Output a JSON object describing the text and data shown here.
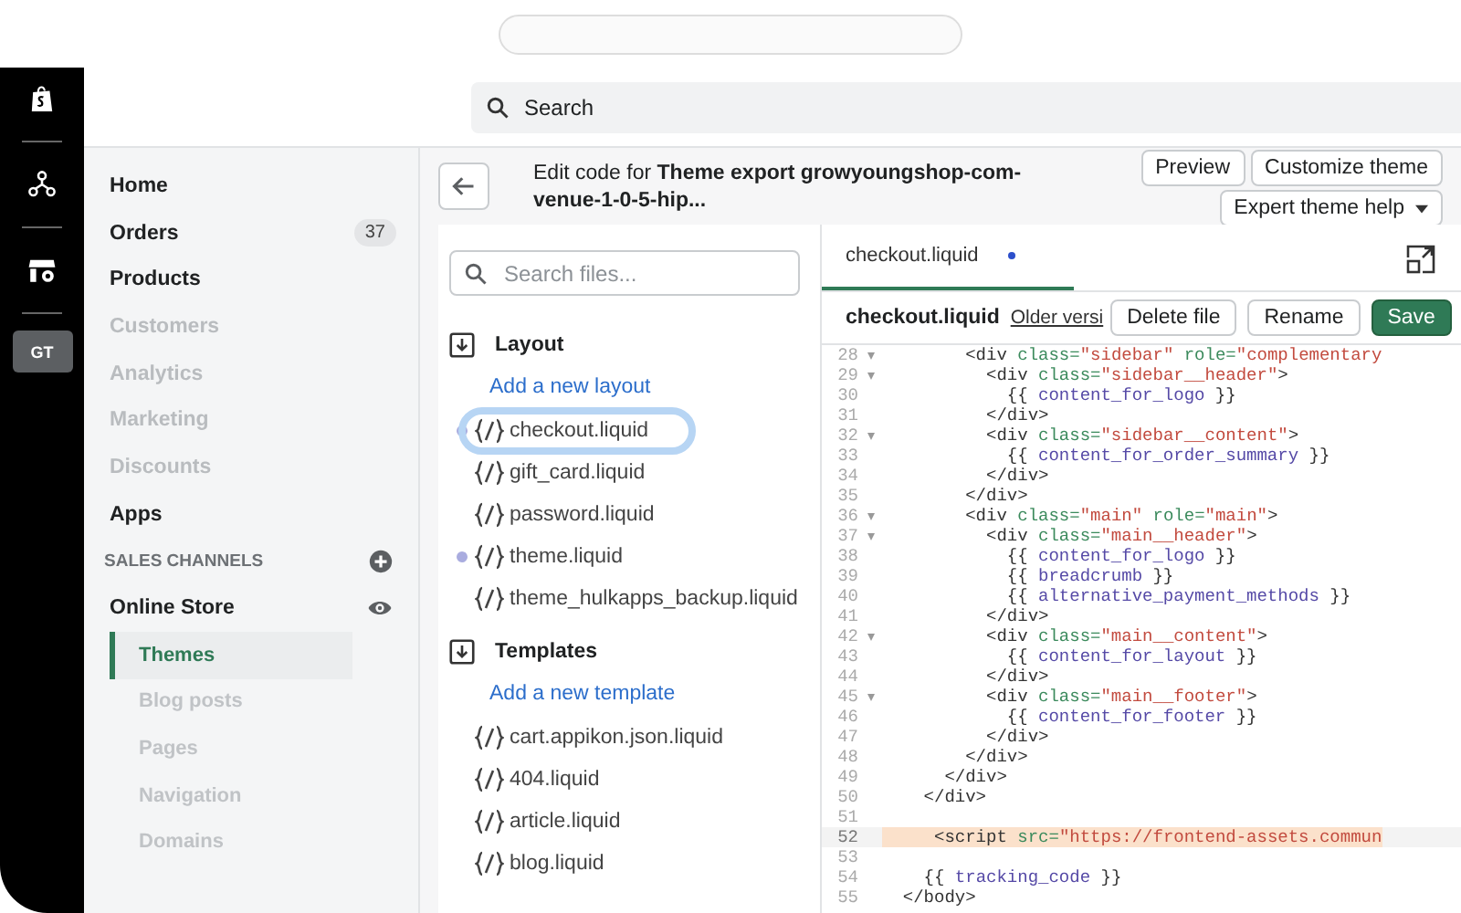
{
  "rail": {
    "avatar": "GT"
  },
  "top_search": {
    "placeholder": "Search"
  },
  "nav": {
    "items": [
      {
        "label": "Home",
        "disabled": false
      },
      {
        "label": "Orders",
        "disabled": false,
        "badge": "37"
      },
      {
        "label": "Products",
        "disabled": false
      },
      {
        "label": "Customers",
        "disabled": true
      },
      {
        "label": "Analytics",
        "disabled": true
      },
      {
        "label": "Marketing",
        "disabled": true
      },
      {
        "label": "Discounts",
        "disabled": true
      },
      {
        "label": "Apps",
        "disabled": false
      }
    ],
    "section_title": "SALES CHANNELS",
    "channel": "Online Store",
    "sub_items": [
      {
        "label": "Themes",
        "selected": true,
        "disabled": false
      },
      {
        "label": "Blog posts",
        "selected": false,
        "disabled": true
      },
      {
        "label": "Pages",
        "selected": false,
        "disabled": true
      },
      {
        "label": "Navigation",
        "selected": false,
        "disabled": true
      },
      {
        "label": "Domains",
        "selected": false,
        "disabled": true
      }
    ]
  },
  "page_header": {
    "title": "Edit code for **Theme export growyoungshop-com-venue-1-0-5-hip...**",
    "buttons": [
      "Preview",
      "Customize theme"
    ],
    "help_button": "Expert theme help"
  },
  "file_search": {
    "placeholder": "Search files..."
  },
  "sections": [
    {
      "title": "Layout",
      "add_link": "Add a new layout",
      "files": [
        {
          "name": "checkout.liquid",
          "modified": true,
          "selected": true
        },
        {
          "name": "gift_card.liquid",
          "modified": false,
          "selected": false
        },
        {
          "name": "password.liquid",
          "modified": false,
          "selected": false
        },
        {
          "name": "theme.liquid",
          "modified": true,
          "selected": false
        },
        {
          "name": "theme_hulkapps_backup.liquid",
          "modified": false,
          "selected": false
        }
      ]
    },
    {
      "title": "Templates",
      "add_link": "Add a new template",
      "files": [
        {
          "name": "cart.appikon.json.liquid",
          "modified": false,
          "selected": false
        },
        {
          "name": "404.liquid",
          "modified": false,
          "selected": false
        },
        {
          "name": "article.liquid",
          "modified": false,
          "selected": false
        },
        {
          "name": "blog.liquid",
          "modified": false,
          "selected": false
        }
      ]
    }
  ],
  "editor": {
    "tabs": [
      {
        "label": "checkout.liquid",
        "unsaved": true,
        "selected": true
      }
    ],
    "file_name": "checkout.liquid",
    "older_link": "Older versi",
    "buttons": [
      {
        "label": "Delete file",
        "kind": "secondary"
      },
      {
        "label": "Rename",
        "kind": "secondary"
      },
      {
        "label": "Save",
        "kind": "primary"
      }
    ],
    "lines": [
      {
        "n": "28",
        "fold": true,
        "active": false,
        "tokens": [
          {
            "kind": "text",
            "t": "        <div "
          },
          {
            "kind": "attr",
            "t": "class="
          },
          {
            "kind": "str",
            "t": "\"sidebar\" "
          },
          {
            "kind": "attr",
            "t": "role="
          },
          {
            "kind": "str",
            "t": "\"complementary"
          }
        ]
      },
      {
        "n": "29",
        "fold": true,
        "active": false,
        "tokens": [
          {
            "kind": "text",
            "t": "          <div "
          },
          {
            "kind": "attr",
            "t": "class="
          },
          {
            "kind": "str",
            "t": "\"sidebar__header\""
          },
          {
            "kind": "text",
            "t": ">"
          }
        ]
      },
      {
        "n": "30",
        "fold": false,
        "active": false,
        "tokens": [
          {
            "kind": "text",
            "t": "            {{ "
          },
          {
            "kind": "var",
            "t": "content_for_logo"
          },
          {
            "kind": "text",
            "t": " }}"
          }
        ]
      },
      {
        "n": "31",
        "fold": false,
        "active": false,
        "tokens": [
          {
            "kind": "text",
            "t": "          </div>"
          }
        ]
      },
      {
        "n": "32",
        "fold": true,
        "active": false,
        "tokens": [
          {
            "kind": "text",
            "t": "          <div "
          },
          {
            "kind": "attr",
            "t": "class="
          },
          {
            "kind": "str",
            "t": "\"sidebar__content\""
          },
          {
            "kind": "text",
            "t": ">"
          }
        ]
      },
      {
        "n": "33",
        "fold": false,
        "active": false,
        "tokens": [
          {
            "kind": "text",
            "t": "            {{ "
          },
          {
            "kind": "var",
            "t": "content_for_order_summary"
          },
          {
            "kind": "text",
            "t": " }}"
          }
        ]
      },
      {
        "n": "34",
        "fold": false,
        "active": false,
        "tokens": [
          {
            "kind": "text",
            "t": "          </div>"
          }
        ]
      },
      {
        "n": "35",
        "fold": false,
        "active": false,
        "tokens": [
          {
            "kind": "text",
            "t": "        </div>"
          }
        ]
      },
      {
        "n": "36",
        "fold": true,
        "active": false,
        "tokens": [
          {
            "kind": "text",
            "t": "        <div "
          },
          {
            "kind": "attr",
            "t": "class="
          },
          {
            "kind": "str",
            "t": "\"main\" "
          },
          {
            "kind": "attr",
            "t": "role="
          },
          {
            "kind": "str",
            "t": "\"main\""
          },
          {
            "kind": "text",
            "t": ">"
          }
        ]
      },
      {
        "n": "37",
        "fold": true,
        "active": false,
        "tokens": [
          {
            "kind": "text",
            "t": "          <div "
          },
          {
            "kind": "attr",
            "t": "class="
          },
          {
            "kind": "str",
            "t": "\"main__header\""
          },
          {
            "kind": "text",
            "t": ">"
          }
        ]
      },
      {
        "n": "38",
        "fold": false,
        "active": false,
        "tokens": [
          {
            "kind": "text",
            "t": "            {{ "
          },
          {
            "kind": "var",
            "t": "content_for_logo"
          },
          {
            "kind": "text",
            "t": " }}"
          }
        ]
      },
      {
        "n": "39",
        "fold": false,
        "active": false,
        "tokens": [
          {
            "kind": "text",
            "t": "            {{ "
          },
          {
            "kind": "var",
            "t": "breadcrumb"
          },
          {
            "kind": "text",
            "t": " }}"
          }
        ]
      },
      {
        "n": "40",
        "fold": false,
        "active": false,
        "tokens": [
          {
            "kind": "text",
            "t": "            {{ "
          },
          {
            "kind": "var",
            "t": "alternative_payment_methods"
          },
          {
            "kind": "text",
            "t": " }}"
          }
        ]
      },
      {
        "n": "41",
        "fold": false,
        "active": false,
        "tokens": [
          {
            "kind": "text",
            "t": "          </div>"
          }
        ]
      },
      {
        "n": "42",
        "fold": true,
        "active": false,
        "tokens": [
          {
            "kind": "text",
            "t": "          <div "
          },
          {
            "kind": "attr",
            "t": "class="
          },
          {
            "kind": "str",
            "t": "\"main__content\""
          },
          {
            "kind": "text",
            "t": ">"
          }
        ]
      },
      {
        "n": "43",
        "fold": false,
        "active": false,
        "tokens": [
          {
            "kind": "text",
            "t": "            {{ "
          },
          {
            "kind": "var",
            "t": "content_for_layout"
          },
          {
            "kind": "text",
            "t": " }}"
          }
        ]
      },
      {
        "n": "44",
        "fold": false,
        "active": false,
        "tokens": [
          {
            "kind": "text",
            "t": "          </div>"
          }
        ]
      },
      {
        "n": "45",
        "fold": true,
        "active": false,
        "tokens": [
          {
            "kind": "text",
            "t": "          <div "
          },
          {
            "kind": "attr",
            "t": "class="
          },
          {
            "kind": "str",
            "t": "\"main__footer\""
          },
          {
            "kind": "text",
            "t": ">"
          }
        ]
      },
      {
        "n": "46",
        "fold": false,
        "active": false,
        "tokens": [
          {
            "kind": "text",
            "t": "            {{ "
          },
          {
            "kind": "var",
            "t": "content_for_footer"
          },
          {
            "kind": "text",
            "t": " }}"
          }
        ]
      },
      {
        "n": "47",
        "fold": false,
        "active": false,
        "tokens": [
          {
            "kind": "text",
            "t": "          </div>"
          }
        ]
      },
      {
        "n": "48",
        "fold": false,
        "active": false,
        "tokens": [
          {
            "kind": "text",
            "t": "        </div>"
          }
        ]
      },
      {
        "n": "49",
        "fold": false,
        "active": false,
        "tokens": [
          {
            "kind": "text",
            "t": "      </div>"
          }
        ]
      },
      {
        "n": "50",
        "fold": false,
        "active": false,
        "tokens": [
          {
            "kind": "text",
            "t": "    </div>"
          }
        ]
      },
      {
        "n": "51",
        "fold": false,
        "active": false
      },
      {
        "n": "52",
        "fold": false,
        "active": true,
        "tokens": [
          {
            "kind": "text",
            "t": "     <script "
          },
          {
            "kind": "attr",
            "t": "src="
          },
          {
            "kind": "str",
            "t": "\"https://frontend-assets.commun"
          }
        ]
      },
      {
        "n": "53",
        "fold": false,
        "active": false
      },
      {
        "n": "54",
        "fold": false,
        "active": false,
        "tokens": [
          {
            "kind": "text",
            "t": "    {{ "
          },
          {
            "kind": "var",
            "t": "tracking_code"
          },
          {
            "kind": "text",
            "t": " }}"
          }
        ]
      },
      {
        "n": "55",
        "fold": false,
        "active": false,
        "tokens": [
          {
            "kind": "text",
            "t": "  </body>"
          }
        ]
      }
    ]
  }
}
